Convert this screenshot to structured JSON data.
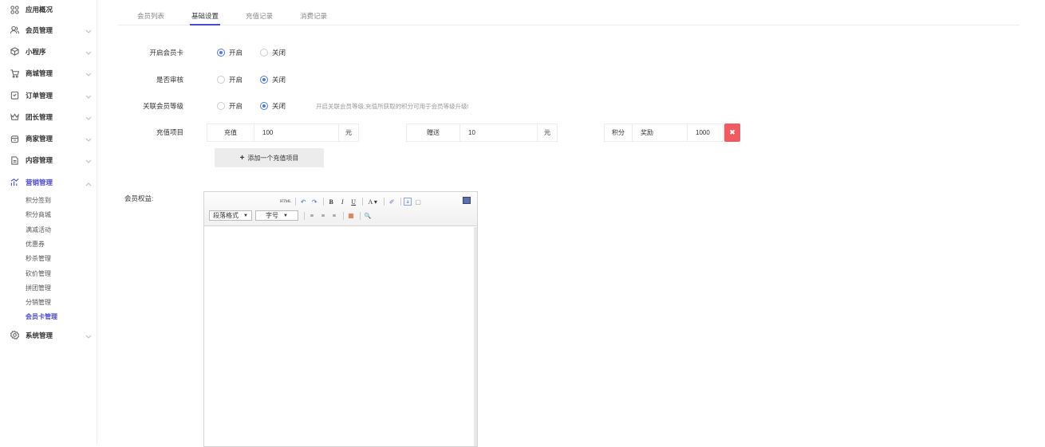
{
  "sidebar": {
    "items": [
      {
        "label": "应用概况",
        "icon": "grid-icon",
        "arrow": false
      },
      {
        "label": "会员管理",
        "icon": "users-icon",
        "arrow": true
      },
      {
        "label": "小程序",
        "icon": "cube-icon",
        "arrow": true
      },
      {
        "label": "商城管理",
        "icon": "cart-icon",
        "arrow": true
      },
      {
        "label": "订单管理",
        "icon": "order-icon",
        "arrow": true
      },
      {
        "label": "团长管理",
        "icon": "crown-icon",
        "arrow": true
      },
      {
        "label": "商家管理",
        "icon": "shop-icon",
        "arrow": true
      },
      {
        "label": "内容管理",
        "icon": "document-icon",
        "arrow": true
      },
      {
        "label": "营销管理",
        "icon": "chart-icon",
        "arrow": true,
        "active": true
      },
      {
        "label": "系统管理",
        "icon": "settings-icon",
        "arrow": true
      }
    ],
    "submenu": [
      "积分签到",
      "积分商城",
      "满减活动",
      "优惠券",
      "秒杀管理",
      "砍价管理",
      "拼团管理",
      "分销管理",
      "会员卡管理"
    ],
    "submenu_active": "会员卡管理"
  },
  "tabs": [
    "会员列表",
    "基础设置",
    "充值记录",
    "消费记录"
  ],
  "active_tab": "基础设置",
  "form": {
    "enable_card": {
      "label": "开启会员卡",
      "options": [
        "开启",
        "关闭"
      ],
      "selected": "开启"
    },
    "audit": {
      "label": "是否审核",
      "options": [
        "开启",
        "关闭"
      ],
      "selected": "关闭"
    },
    "link_level": {
      "label": "关联会员等级",
      "options": [
        "开启",
        "关闭"
      ],
      "selected": "关闭",
      "hint": "开启关联会员等级,充值所获取的积分可用于会员等级升级!"
    },
    "recharge": {
      "label": "充值项目",
      "recharge_label": "充值",
      "recharge_value": "100",
      "unit1": "元",
      "gift_label": "赠送",
      "gift_value": "10",
      "unit2": "元",
      "points_label": "积分",
      "reward_label": "奖励",
      "points_value": "1000",
      "delete_icon": "✖"
    },
    "add_button": "添加一个充值项目",
    "benefit_label": "会员权益:"
  },
  "editor": {
    "row1": [
      "HTML",
      "↶",
      "↷",
      "B",
      "I",
      "U",
      "A ▾",
      "✐",
      "a",
      "▢"
    ],
    "paragraph_select": "段落格式",
    "font_size_select": "字号",
    "row2_icons": [
      "≡",
      "≡",
      "≡",
      "▦",
      "🔍"
    ]
  },
  "colors": {
    "accent": "#4b4bd6",
    "radio": "#4b78e6",
    "danger": "#ef5a63"
  }
}
